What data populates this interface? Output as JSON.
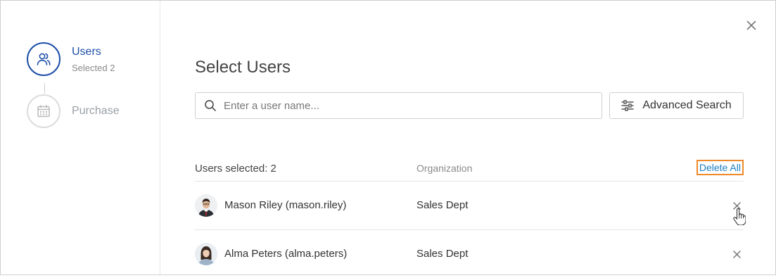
{
  "steps": [
    {
      "label": "Users",
      "sub": "Selected 2",
      "icon": "users-icon",
      "state": "active"
    },
    {
      "label": "Purchase",
      "icon": "calendar-icon",
      "state": "inactive"
    }
  ],
  "title": "Select Users",
  "search": {
    "placeholder": "Enter a user name...",
    "value": ""
  },
  "advanced_search_label": "Advanced Search",
  "list": {
    "count_label": "Users selected: 2",
    "org_header": "Organization",
    "delete_all_label": "Delete All",
    "rows": [
      {
        "name": "Mason Riley (mason.riley)",
        "org": "Sales Dept"
      },
      {
        "name": "Alma Peters (alma.peters)",
        "org": "Sales Dept"
      }
    ]
  },
  "colors": {
    "accent": "#1e4fa8",
    "link": "#1a7fc1",
    "highlight": "#ee8a2a"
  }
}
